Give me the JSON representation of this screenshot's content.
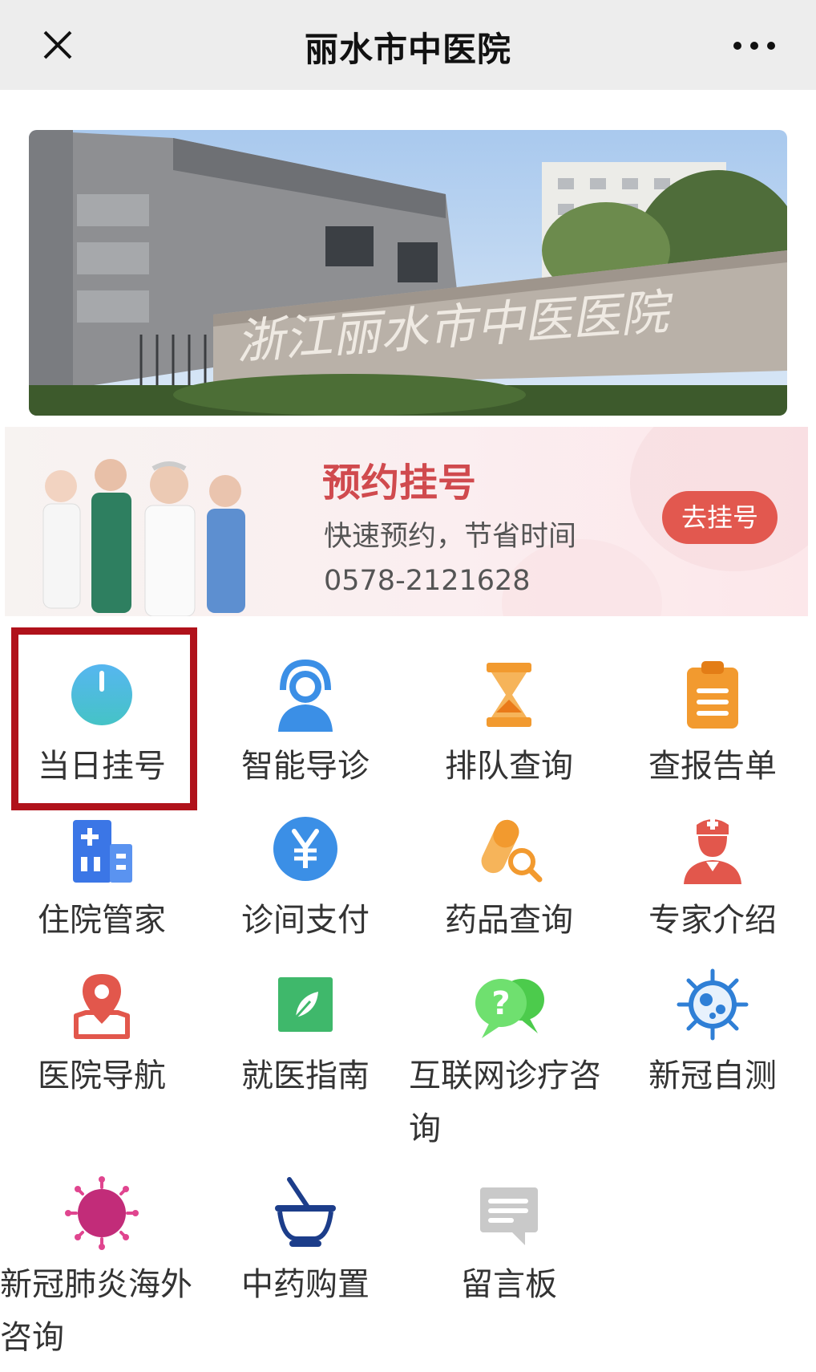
{
  "header": {
    "title": "丽水市中医院"
  },
  "banner": {
    "sign_text": "浙江丽水市中医医院"
  },
  "appointment": {
    "title": "预约挂号",
    "subtitle": "快速预约，节省时间",
    "phone": "0578-2121628",
    "button_label": "去挂号"
  },
  "grid": [
    {
      "label": "当日挂号",
      "icon": "clock-icon"
    },
    {
      "label": "智能导诊",
      "icon": "headset-agent-icon"
    },
    {
      "label": "排队查询",
      "icon": "hourglass-icon"
    },
    {
      "label": "查报告单",
      "icon": "clipboard-icon"
    },
    {
      "label": "住院管家",
      "icon": "hospital-building-icon"
    },
    {
      "label": "诊间支付",
      "icon": "yen-coin-icon"
    },
    {
      "label": "药品查询",
      "icon": "pill-search-icon"
    },
    {
      "label": "专家介绍",
      "icon": "nurse-icon"
    },
    {
      "label": "医院导航",
      "icon": "map-pin-icon"
    },
    {
      "label": "就医指南",
      "icon": "leaf-square-icon"
    },
    {
      "label": "互联网诊疗咨询",
      "icon": "question-chat-icon"
    },
    {
      "label": "新冠自测",
      "icon": "virus-blue-icon"
    },
    {
      "label": "新冠肺炎海外咨询",
      "icon": "virus-magenta-icon"
    },
    {
      "label": "中药购置",
      "icon": "mortar-pestle-icon"
    },
    {
      "label": "留言板",
      "icon": "message-board-icon"
    }
  ],
  "colors": {
    "header_bg": "#ededed",
    "accent_red": "#e2584f",
    "highlight_border": "#b0121b"
  }
}
